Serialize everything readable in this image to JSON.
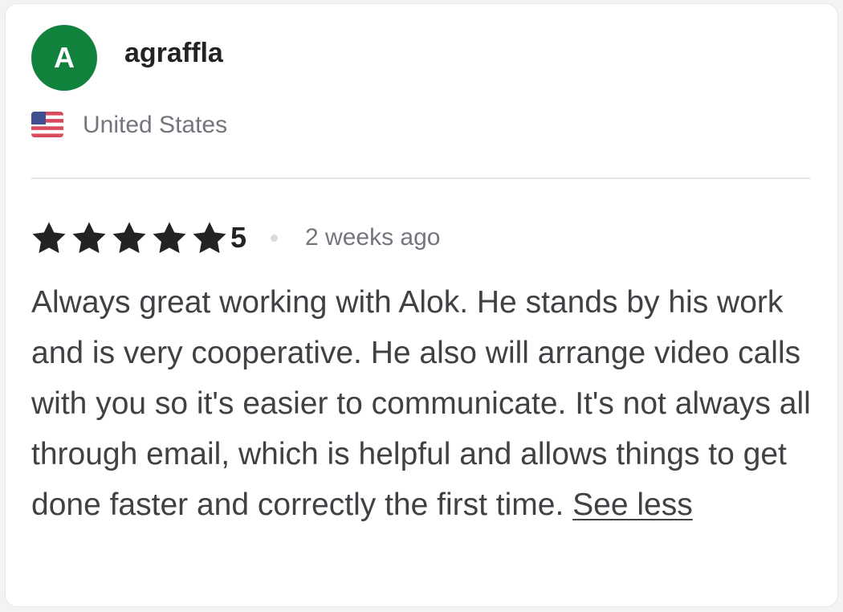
{
  "reviewer": {
    "initial": "A",
    "username": "agraffla",
    "avatar_color": "#11823b",
    "country": "United States",
    "flag_icon": "us-flag-icon"
  },
  "rating": {
    "value": "5",
    "stars": 5,
    "time_ago": "2 weeks ago",
    "star_color": "#222325"
  },
  "review": {
    "text": "Always great working with Alok. He stands by his work and is very cooperative. He also will arrange video calls with you so it's easier to communicate. It's not always all through email, which is helpful and allows things to get done faster and correctly the first time.",
    "see_less_label": "See less"
  }
}
